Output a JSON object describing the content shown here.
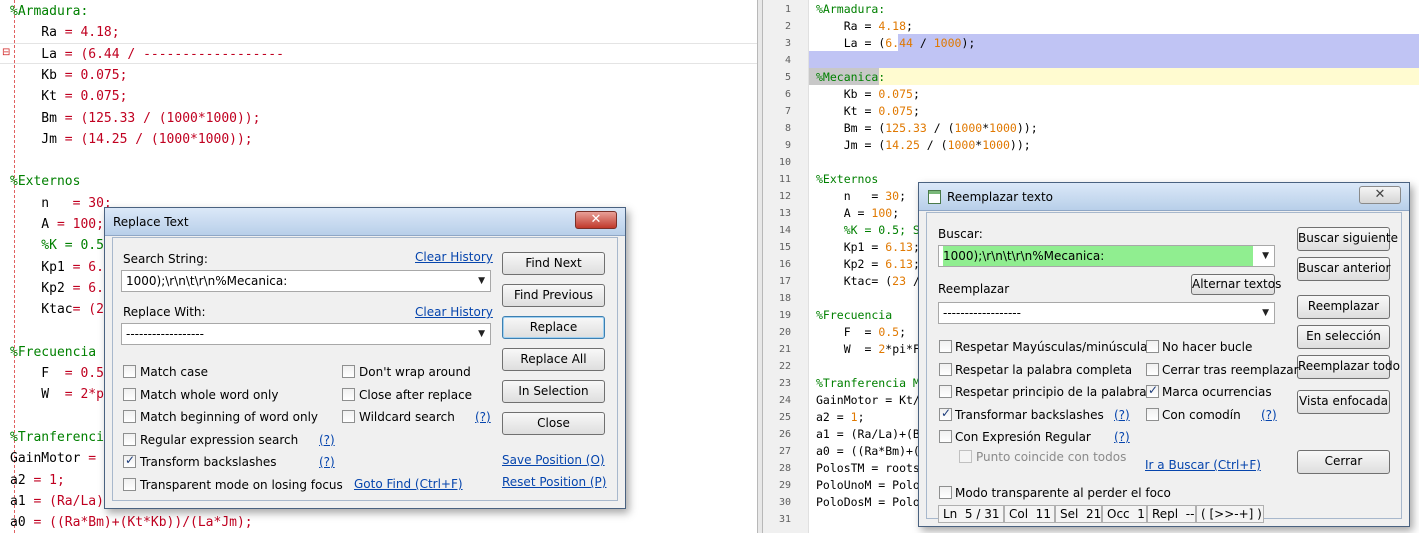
{
  "left_editor": {
    "lines": [
      {
        "parts": [
          {
            "t": "%Armadura:",
            "c": "c-com"
          }
        ]
      },
      {
        "parts": [
          {
            "t": "    Ra ",
            "c": "c-kw"
          },
          {
            "t": "= 4.18;",
            "c": "c-red"
          }
        ]
      },
      {
        "parts": [
          {
            "t": "    La ",
            "c": "c-kw"
          },
          {
            "t": "= (6.44 / ------------------",
            "c": "c-red"
          }
        ]
      },
      {
        "parts": [
          {
            "t": "    Kb ",
            "c": "c-kw"
          },
          {
            "t": "= 0.075;",
            "c": "c-red"
          }
        ]
      },
      {
        "parts": [
          {
            "t": "    Kt ",
            "c": "c-kw"
          },
          {
            "t": "= 0.075;",
            "c": "c-red"
          }
        ]
      },
      {
        "parts": [
          {
            "t": "    Bm ",
            "c": "c-kw"
          },
          {
            "t": "= (125.33 / (1000*1000));",
            "c": "c-red"
          }
        ]
      },
      {
        "parts": [
          {
            "t": "    Jm ",
            "c": "c-kw"
          },
          {
            "t": "= (14.25 / (1000*1000));",
            "c": "c-red"
          }
        ]
      },
      {
        "parts": [
          {
            "t": "",
            "c": "c-kw"
          }
        ]
      },
      {
        "parts": [
          {
            "t": "%Externos",
            "c": "c-com"
          }
        ]
      },
      {
        "parts": [
          {
            "t": "    n  ",
            "c": "c-kw"
          },
          {
            "t": " = 30;",
            "c": "c-red"
          }
        ]
      },
      {
        "parts": [
          {
            "t": "    A ",
            "c": "c-kw"
          },
          {
            "t": "= 100;",
            "c": "c-red"
          }
        ]
      },
      {
        "parts": [
          {
            "t": "    %K = 0.5",
            "c": "c-com"
          }
        ]
      },
      {
        "parts": [
          {
            "t": "    Kp1 ",
            "c": "c-kw"
          },
          {
            "t": "= 6.",
            "c": "c-red"
          }
        ]
      },
      {
        "parts": [
          {
            "t": "    Kp2 ",
            "c": "c-kw"
          },
          {
            "t": "= 6.",
            "c": "c-red"
          }
        ]
      },
      {
        "parts": [
          {
            "t": "    Ktac",
            "c": "c-kw"
          },
          {
            "t": "= (2",
            "c": "c-red"
          }
        ]
      },
      {
        "parts": [
          {
            "t": "",
            "c": "c-kw"
          }
        ]
      },
      {
        "parts": [
          {
            "t": "%Frecuencia",
            "c": "c-com"
          }
        ]
      },
      {
        "parts": [
          {
            "t": "    F  ",
            "c": "c-kw"
          },
          {
            "t": "= 0.5",
            "c": "c-red"
          }
        ]
      },
      {
        "parts": [
          {
            "t": "    W  ",
            "c": "c-kw"
          },
          {
            "t": "= 2*p",
            "c": "c-red"
          }
        ]
      },
      {
        "parts": [
          {
            "t": "",
            "c": "c-kw"
          }
        ]
      },
      {
        "parts": [
          {
            "t": "%Tranferenci",
            "c": "c-com"
          }
        ]
      },
      {
        "parts": [
          {
            "t": "GainMotor ",
            "c": "c-kw"
          },
          {
            "t": "=",
            "c": "c-red"
          }
        ]
      },
      {
        "parts": [
          {
            "t": "a2 ",
            "c": "c-kw"
          },
          {
            "t": "= 1;",
            "c": "c-red"
          }
        ]
      },
      {
        "parts": [
          {
            "t": "a1 ",
            "c": "c-kw"
          },
          {
            "t": "= (Ra/La)",
            "c": "c-red"
          }
        ]
      },
      {
        "parts": [
          {
            "t": "a0 ",
            "c": "c-kw"
          },
          {
            "t": "= ((Ra*Bm)+(Kt*Kb))/(La*Jm);",
            "c": "c-red"
          }
        ]
      }
    ]
  },
  "right_editor": {
    "line_numbers": [
      "1",
      "2",
      "3",
      "4",
      "5",
      "6",
      "7",
      "8",
      "9",
      "10",
      "11",
      "12",
      "13",
      "14",
      "15",
      "16",
      "17",
      "18",
      "19",
      "20",
      "21",
      "22",
      "23",
      "24",
      "25",
      "26",
      "27",
      "28",
      "29",
      "30",
      "31"
    ],
    "lines": [
      {
        "parts": [
          {
            "t": "%Armadura:",
            "c": "c-com"
          }
        ]
      },
      {
        "parts": [
          {
            "t": "    Ra ",
            "c": "c-kw"
          },
          {
            "t": "= ",
            "c": "c-kw"
          },
          {
            "t": "4.18",
            "c": "c-num"
          },
          {
            "t": ";",
            "c": "c-kw"
          }
        ]
      },
      {
        "parts": [
          {
            "t": "    La ",
            "c": "c-kw"
          },
          {
            "t": "= (",
            "c": "c-kw"
          },
          {
            "t": "6.44",
            "c": "c-num"
          },
          {
            "t": " / ",
            "c": "c-kw"
          },
          {
            "t": "1000",
            "c": "c-num"
          },
          {
            "t": ");",
            "c": "c-kw"
          }
        ]
      },
      {
        "parts": [
          {
            "t": "",
            "c": "c-kw"
          }
        ]
      },
      {
        "parts": [
          {
            "t": "%Mecanica:",
            "c": "c-com"
          }
        ]
      },
      {
        "parts": [
          {
            "t": "    Kb ",
            "c": "c-kw"
          },
          {
            "t": "= ",
            "c": "c-kw"
          },
          {
            "t": "0.075",
            "c": "c-num"
          },
          {
            "t": ";",
            "c": "c-kw"
          }
        ]
      },
      {
        "parts": [
          {
            "t": "    Kt ",
            "c": "c-kw"
          },
          {
            "t": "= ",
            "c": "c-kw"
          },
          {
            "t": "0.075",
            "c": "c-num"
          },
          {
            "t": ";",
            "c": "c-kw"
          }
        ]
      },
      {
        "parts": [
          {
            "t": "    Bm ",
            "c": "c-kw"
          },
          {
            "t": "= (",
            "c": "c-kw"
          },
          {
            "t": "125.33",
            "c": "c-num"
          },
          {
            "t": " / (",
            "c": "c-kw"
          },
          {
            "t": "1000",
            "c": "c-num"
          },
          {
            "t": "*",
            "c": "c-kw"
          },
          {
            "t": "1000",
            "c": "c-num"
          },
          {
            "t": "));",
            "c": "c-kw"
          }
        ]
      },
      {
        "parts": [
          {
            "t": "    Jm ",
            "c": "c-kw"
          },
          {
            "t": "= (",
            "c": "c-kw"
          },
          {
            "t": "14.25",
            "c": "c-num"
          },
          {
            "t": " / (",
            "c": "c-kw"
          },
          {
            "t": "1000",
            "c": "c-num"
          },
          {
            "t": "*",
            "c": "c-kw"
          },
          {
            "t": "1000",
            "c": "c-num"
          },
          {
            "t": "));",
            "c": "c-kw"
          }
        ]
      },
      {
        "parts": [
          {
            "t": "",
            "c": "c-kw"
          }
        ]
      },
      {
        "parts": [
          {
            "t": "%Externos",
            "c": "c-com"
          }
        ]
      },
      {
        "parts": [
          {
            "t": "    n   ",
            "c": "c-kw"
          },
          {
            "t": "= ",
            "c": "c-kw"
          },
          {
            "t": "30",
            "c": "c-num"
          },
          {
            "t": ";",
            "c": "c-kw"
          }
        ]
      },
      {
        "parts": [
          {
            "t": "    A ",
            "c": "c-kw"
          },
          {
            "t": "= ",
            "c": "c-kw"
          },
          {
            "t": "100",
            "c": "c-num"
          },
          {
            "t": ";",
            "c": "c-kw"
          }
        ]
      },
      {
        "parts": [
          {
            "t": "    %K = 0.5; S",
            "c": "c-com"
          }
        ]
      },
      {
        "parts": [
          {
            "t": "    Kp1 ",
            "c": "c-kw"
          },
          {
            "t": "= ",
            "c": "c-kw"
          },
          {
            "t": "6.13",
            "c": "c-num"
          },
          {
            "t": ";",
            "c": "c-kw"
          }
        ]
      },
      {
        "parts": [
          {
            "t": "    Kp2 ",
            "c": "c-kw"
          },
          {
            "t": "= ",
            "c": "c-kw"
          },
          {
            "t": "6.13",
            "c": "c-num"
          },
          {
            "t": ";",
            "c": "c-kw"
          }
        ]
      },
      {
        "parts": [
          {
            "t": "    Ktac= (",
            "c": "c-kw"
          },
          {
            "t": "23",
            "c": "c-num"
          },
          {
            "t": " /",
            "c": "c-kw"
          }
        ]
      },
      {
        "parts": [
          {
            "t": "",
            "c": "c-kw"
          }
        ]
      },
      {
        "parts": [
          {
            "t": "%Frecuencia",
            "c": "c-com"
          }
        ]
      },
      {
        "parts": [
          {
            "t": "    F  ",
            "c": "c-kw"
          },
          {
            "t": "= ",
            "c": "c-kw"
          },
          {
            "t": "0.5",
            "c": "c-num"
          },
          {
            "t": ";",
            "c": "c-kw"
          }
        ]
      },
      {
        "parts": [
          {
            "t": "    W  ",
            "c": "c-kw"
          },
          {
            "t": "= ",
            "c": "c-kw"
          },
          {
            "t": "2",
            "c": "c-num"
          },
          {
            "t": "*pi*F",
            "c": "c-kw"
          }
        ]
      },
      {
        "parts": [
          {
            "t": "",
            "c": "c-kw"
          }
        ]
      },
      {
        "parts": [
          {
            "t": "%Tranferencia M",
            "c": "c-com"
          }
        ]
      },
      {
        "parts": [
          {
            "t": "GainMotor = Kt/",
            "c": "c-kw"
          }
        ]
      },
      {
        "parts": [
          {
            "t": "a2 = ",
            "c": "c-kw"
          },
          {
            "t": "1",
            "c": "c-num"
          },
          {
            "t": ";",
            "c": "c-kw"
          }
        ]
      },
      {
        "parts": [
          {
            "t": "a1 = (Ra/La)+(B",
            "c": "c-kw"
          }
        ]
      },
      {
        "parts": [
          {
            "t": "a0 = ((Ra*Bm)+(",
            "c": "c-kw"
          }
        ]
      },
      {
        "parts": [
          {
            "t": "PolosTM = roots",
            "c": "c-kw"
          }
        ]
      },
      {
        "parts": [
          {
            "t": "PoloUnoM = Polo",
            "c": "c-kw"
          }
        ]
      },
      {
        "parts": [
          {
            "t": "PoloDosM = Polo",
            "c": "c-kw"
          }
        ]
      },
      {
        "parts": [
          {
            "t": "",
            "c": "c-kw"
          }
        ]
      }
    ]
  },
  "replace_dialog": {
    "title": "Replace Text",
    "search_label": "Search String:",
    "search_value": "1000);\\r\\n\\t\\r\\n%Mecanica:",
    "replace_label": "Replace With:",
    "replace_value": "------------------",
    "clear_history": "Clear History",
    "buttons": [
      "Find Next",
      "Find Previous",
      "Replace",
      "Replace All",
      "In Selection",
      "Close"
    ],
    "options_left": [
      {
        "label": "Match case",
        "checked": false
      },
      {
        "label": "Match whole word only",
        "checked": false
      },
      {
        "label": "Match beginning of word only",
        "checked": false
      },
      {
        "label": "Regular expression search",
        "checked": false,
        "help": true
      },
      {
        "label": "Transform backslashes",
        "checked": true,
        "help": true
      },
      {
        "label": "Transparent mode on losing focus",
        "checked": false
      }
    ],
    "options_right": [
      {
        "label": "Don't wrap around",
        "checked": false
      },
      {
        "label": "Close after replace",
        "checked": false
      },
      {
        "label": "Wildcard search",
        "checked": false,
        "help": true
      }
    ],
    "help_text": "(?)",
    "goto_find": "Goto Find (Ctrl+F)",
    "save_position": "Save Position (O)",
    "reset_position": "Reset Position (P)"
  },
  "reemplazar_dialog": {
    "title": "Reemplazar texto",
    "buscar_label": "Buscar:",
    "buscar_value": "1000);\\r\\n\\t\\r\\n%Mecanica:",
    "reemplazar_label": "Reemplazar",
    "reemplazar_value": "------------------",
    "alternar": "Alternar textos",
    "buttons": [
      "Buscar siguiente",
      "Buscar anterior",
      "Reemplazar",
      "En selección",
      "Reemplazar todo",
      "Vista enfocada",
      "Cerrar"
    ],
    "options_left": [
      {
        "label": "Respetar Mayúsculas/minúsculas",
        "checked": false
      },
      {
        "label": "Respetar la palabra completa",
        "checked": false
      },
      {
        "label": "Respetar principio de la palabra",
        "checked": false
      },
      {
        "label": "Transformar backslashes",
        "checked": true,
        "help": true
      },
      {
        "label": "Con Expresión Regular",
        "checked": false,
        "help": true
      }
    ],
    "options_right": [
      {
        "label": "No hacer bucle",
        "checked": false
      },
      {
        "label": "Cerrar tras reemplazar",
        "checked": false
      },
      {
        "label": "Marca ocurrencias",
        "checked": true
      },
      {
        "label": "Con comodín",
        "checked": false,
        "help": true
      }
    ],
    "punto": "Punto coincide con todos",
    "ir_buscar": "Ir a Buscar (Ctrl+F)",
    "transparente": "Modo transparente al perder el foco",
    "help_text": "(?)",
    "status": [
      "Ln  5 / 31",
      "Col  11",
      "Sel  21",
      "Occ  1",
      "Repl  --",
      "( [>>-+] )"
    ]
  },
  "colors": {
    "accent": "#0645ad",
    "search_match": "#90ee90",
    "selection": "#c0c4f4"
  }
}
